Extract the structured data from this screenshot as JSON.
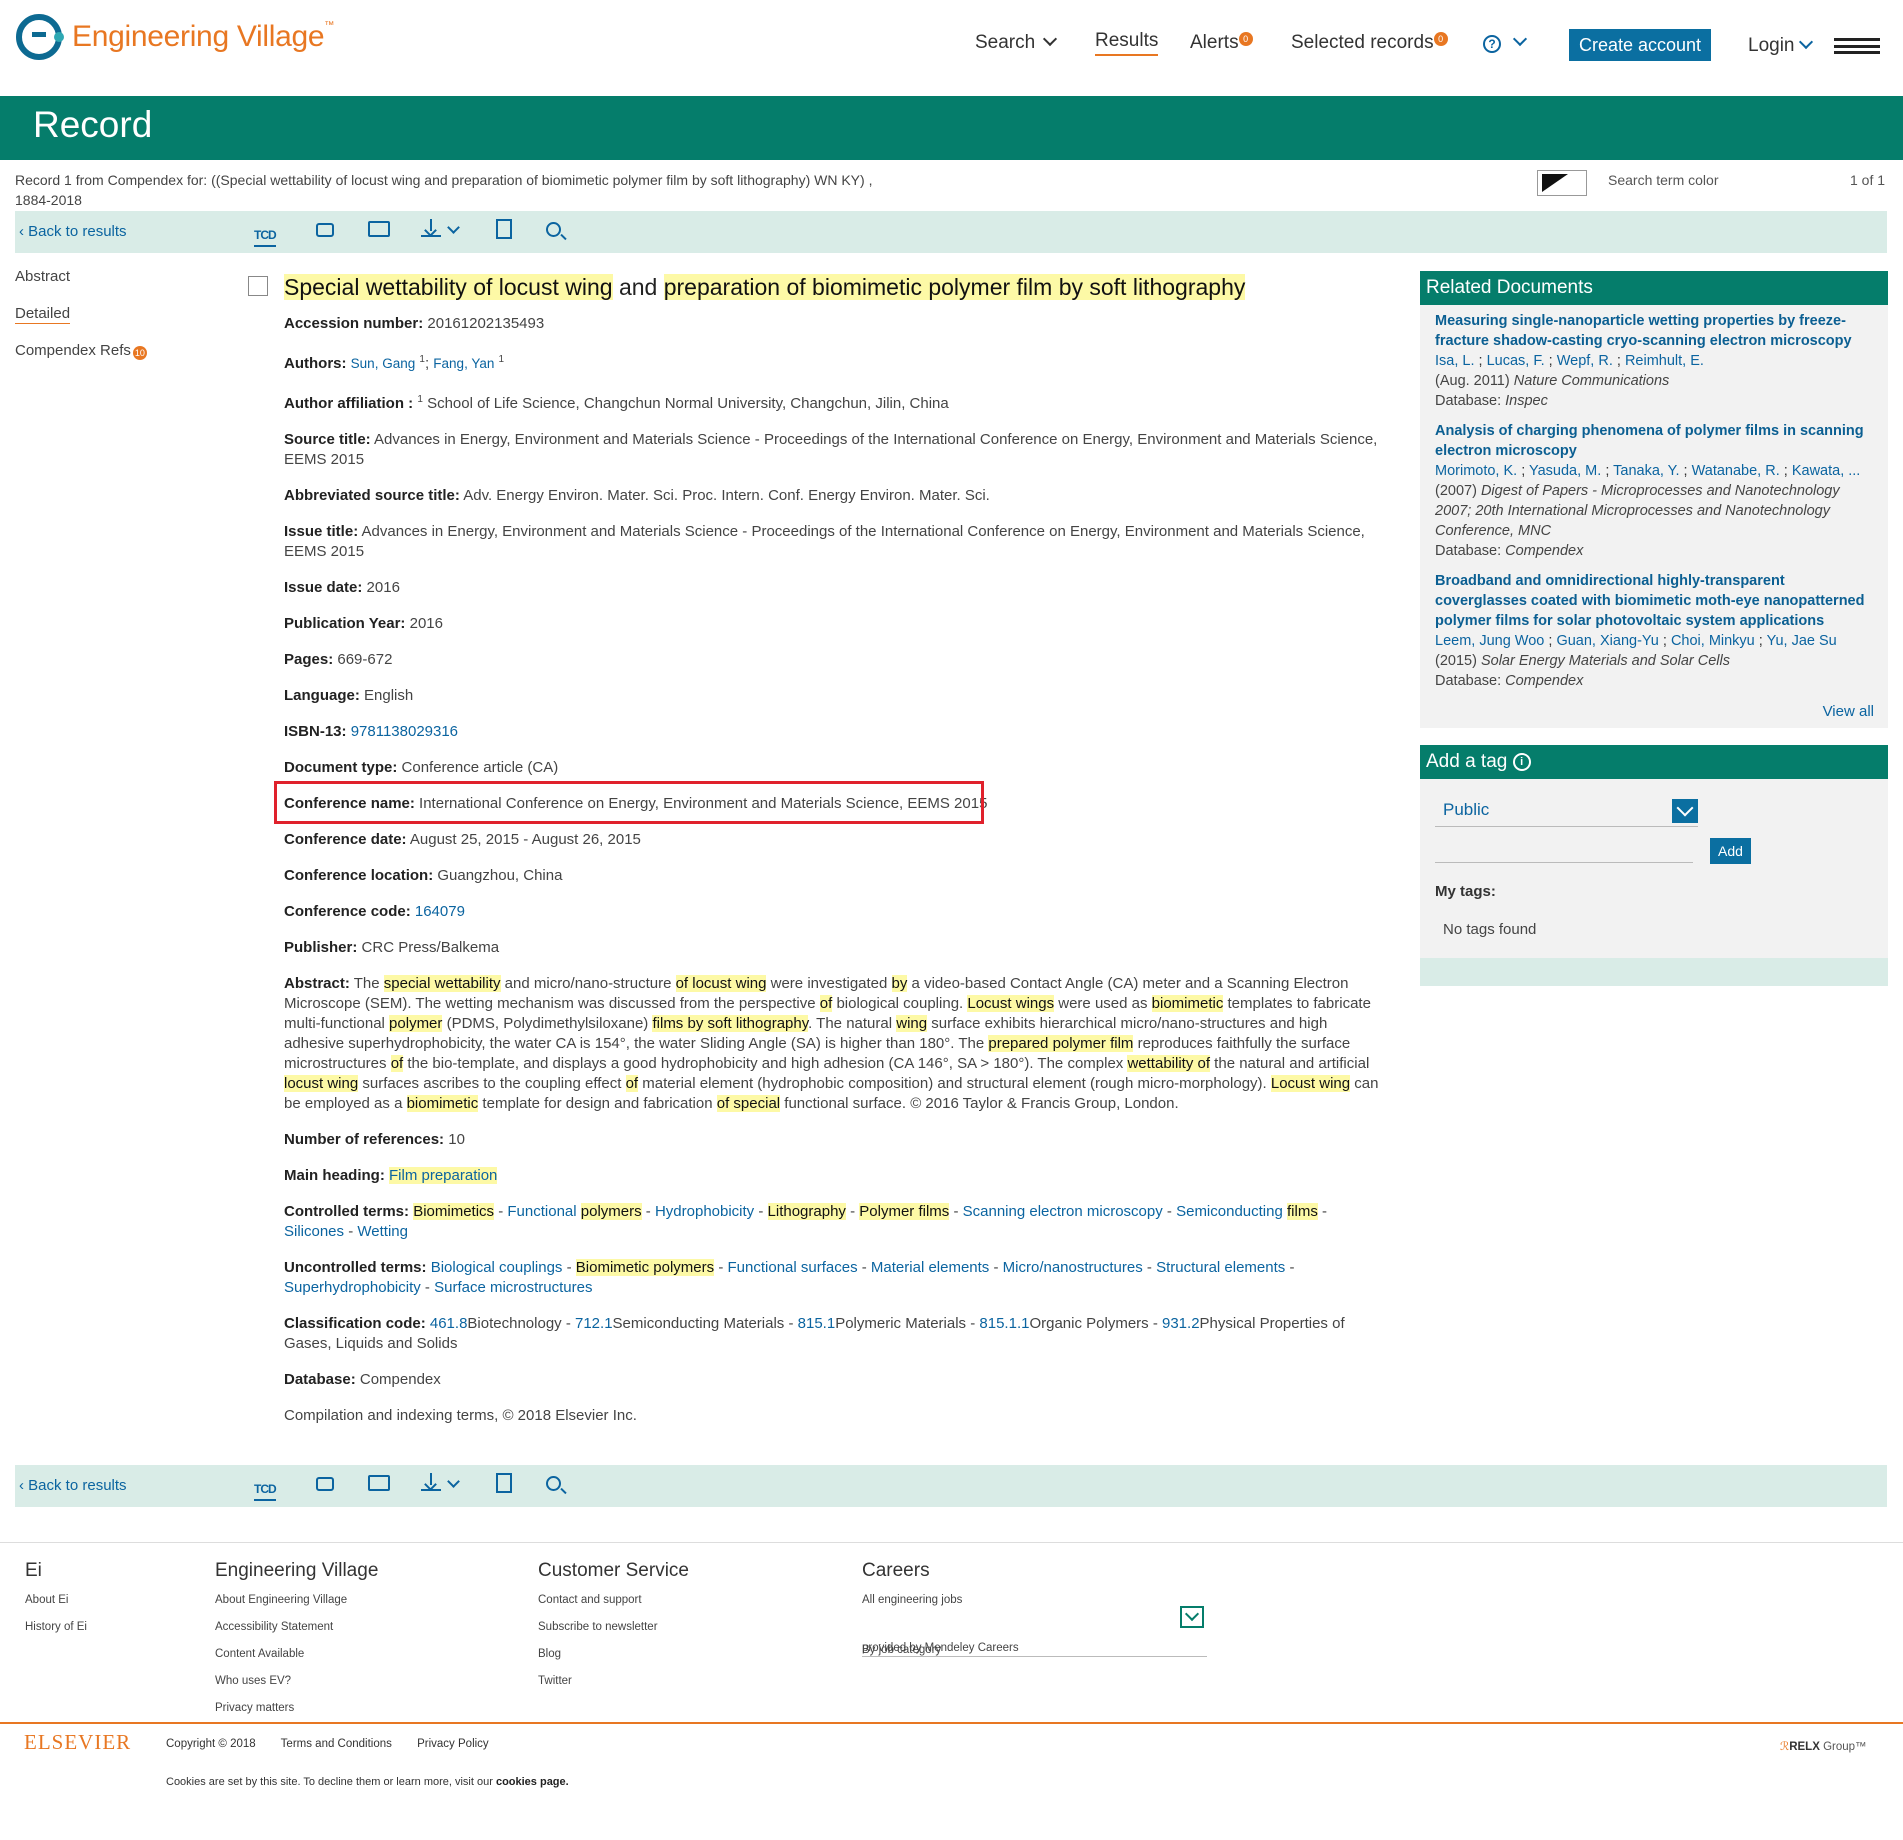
{
  "header": {
    "logo_text": "Engineering Village",
    "logo_tm": "™",
    "nav": {
      "search": "Search",
      "results": "Results",
      "alerts": "Alerts",
      "alerts_count": "0",
      "selected": "Selected records",
      "selected_count": "0",
      "help": "?",
      "create": "Create account",
      "login": "Login"
    }
  },
  "band_title": "Record",
  "crumb": {
    "line1": "Record 1 from Compendex for: ((Special wettability of locust wing and preparation of biomimetic polymer film by soft lithography) WN KY) ,",
    "line2": "1884-2018",
    "search_term_color": "Search term color",
    "pager": "1 of 1"
  },
  "toolbar": {
    "back": "Back to results",
    "tcd": "TCD"
  },
  "leftnav": {
    "abstract": "Abstract",
    "detailed": "Detailed",
    "refs": "Compendex Refs",
    "refs_count": "10"
  },
  "record": {
    "title_parts": [
      "Special wettability of locust wing",
      " and ",
      "preparation of biomimetic polymer film by soft lithography"
    ],
    "accession_label": "Accession number:",
    "accession": "20161202135493",
    "authors_label": "Authors:",
    "author1": "Sun, Gang",
    "author2": "Fang, Yan",
    "sup": "1",
    "affiliation_label": "Author affiliation :",
    "affiliation": "School of Life Science, Changchun Normal University, Changchun, Jilin, China",
    "source_label": "Source title:",
    "source": "Advances in Energy, Environment and Materials Science - Proceedings of the International Conference on Energy, Environment and Materials Science, EEMS 2015",
    "abbr_label": "Abbreviated source title:",
    "abbr": "Adv. Energy Environ. Mater. Sci. Proc. Intern. Conf. Energy Environ. Mater. Sci.",
    "issue_title_label": "Issue title:",
    "issue_title": "Advances in Energy, Environment and Materials Science - Proceedings of the International Conference on Energy, Environment and Materials Science, EEMS 2015",
    "issue_date_label": "Issue date:",
    "issue_date": "2016",
    "pub_year_label": "Publication Year:",
    "pub_year": "2016",
    "pages_label": "Pages:",
    "pages": "669-672",
    "language_label": "Language:",
    "language": "English",
    "isbn_label": "ISBN-13:",
    "isbn": "9781138029316",
    "doctype_label": "Document type:",
    "doctype": "Conference article (CA)",
    "conf_name_label": "Conference name:",
    "conf_name": "International Conference on Energy, Environment and Materials Science, EEMS 2015",
    "conf_date_label": "Conference date:",
    "conf_date": "August 25, 2015 - August 26, 2015",
    "conf_loc_label": "Conference location:",
    "conf_loc": "Guangzhou, China",
    "conf_code_label": "Conference code:",
    "conf_code": "164079",
    "publisher_label": "Publisher:",
    "publisher": "CRC Press/Balkema",
    "abstract_label": "Abstract:",
    "abstract": [
      [
        "The ",
        ""
      ],
      [
        "special wettability",
        "h"
      ],
      [
        " and micro/nano-structure ",
        ""
      ],
      [
        "of locust wing",
        "h"
      ],
      [
        " were investigated ",
        ""
      ],
      [
        "by",
        "h"
      ],
      [
        " a video-based Contact Angle (CA) meter and a Scanning Electron Microscope (SEM). The wetting mechanism was discussed from the perspective ",
        ""
      ],
      [
        "of",
        "h"
      ],
      [
        " biological coupling. ",
        ""
      ],
      [
        "Locust wings",
        "h"
      ],
      [
        " were used as ",
        ""
      ],
      [
        "biomimetic",
        "h"
      ],
      [
        " templates to fabricate multi-functional ",
        ""
      ],
      [
        "polymer",
        "h"
      ],
      [
        " (PDMS, Polydimethylsiloxane) ",
        ""
      ],
      [
        "films by soft lithography",
        "h"
      ],
      [
        ". The natural ",
        ""
      ],
      [
        "wing",
        "h"
      ],
      [
        " surface exhibits hierarchical micro/nano-structures and high adhesive superhydrophobicity, the water CA is 154°, the water Sliding Angle (SA) is higher than 180°. The ",
        ""
      ],
      [
        "prepared polymer film",
        "h"
      ],
      [
        " reproduces faithfully the surface microstructures ",
        ""
      ],
      [
        "of",
        "h"
      ],
      [
        " the bio-template, and displays a good hydrophobicity and high adhesion (CA 146°, SA > 180°). The complex ",
        ""
      ],
      [
        "wettability of",
        "h"
      ],
      [
        " the natural and artificial ",
        ""
      ],
      [
        "locust wing",
        "h"
      ],
      [
        " surfaces ascribes to the coupling effect ",
        ""
      ],
      [
        "of",
        "h"
      ],
      [
        " material element (hydrophobic composition) and structural element (rough micro-morphology). ",
        ""
      ],
      [
        "Locust wing",
        "h"
      ],
      [
        " can be employed as a ",
        ""
      ],
      [
        "biomimetic",
        "h"
      ],
      [
        " template for design and fabrication ",
        ""
      ],
      [
        "of special",
        "h"
      ],
      [
        " functional surface. © 2016 Taylor & Francis Group, London.",
        ""
      ]
    ],
    "nrefs_label": "Number of references:",
    "nrefs": "10",
    "heading_label": "Main heading:",
    "heading": "Film preparation",
    "controlled_label": "Controlled terms:",
    "controlled": [
      [
        [
          "Biomimetics",
          "h"
        ]
      ],
      [
        [
          "Functional ",
          ""
        ],
        [
          "polymers",
          "h"
        ]
      ],
      [
        [
          "Hydrophobicity",
          ""
        ]
      ],
      [
        [
          "Lithography",
          "h"
        ]
      ],
      [
        [
          "Polymer films",
          "h"
        ]
      ],
      [
        [
          "Scanning electron microscopy",
          ""
        ]
      ],
      [
        [
          "Semiconducting ",
          ""
        ],
        [
          "films",
          "h"
        ]
      ],
      [
        [
          "Silicones",
          ""
        ]
      ],
      [
        [
          "Wetting",
          ""
        ]
      ]
    ],
    "uncontrolled_label": "Uncontrolled terms:",
    "uncontrolled": [
      [
        [
          "Biological couplings",
          ""
        ]
      ],
      [
        [
          "Biomimetic polymers",
          "h"
        ]
      ],
      [
        [
          "Functional surfaces",
          ""
        ]
      ],
      [
        [
          "Material elements",
          ""
        ]
      ],
      [
        [
          "Micro/nanostructures",
          ""
        ]
      ],
      [
        [
          "Structural elements",
          ""
        ]
      ],
      [
        [
          "Superhydrophobicity",
          ""
        ]
      ],
      [
        [
          "Surface microstructures",
          ""
        ]
      ]
    ],
    "class_label": "Classification code:",
    "classes": [
      [
        "461.8",
        "Biotechnology"
      ],
      [
        "712.1",
        "Semiconducting Materials"
      ],
      [
        "815.1",
        "Polymeric Materials"
      ],
      [
        "815.1.1",
        "Organic Polymers"
      ],
      [
        "931.2",
        "Physical Properties of Gases, Liquids and Solids"
      ]
    ],
    "database_label": "Database:",
    "database": "Compendex",
    "compilation": "Compilation and indexing terms, © 2018 Elsevier Inc."
  },
  "related": {
    "title": "Related Documents",
    "items": [
      {
        "title": "Measuring single-nanoparticle wetting properties by freeze-fracture shadow-casting cryo-scanning electron microscopy",
        "authors": [
          "Isa, L.",
          "Lucas, F.",
          "Wepf, R.",
          "Reimhult, E."
        ],
        "source_prefix": "(Aug. 2011) ",
        "source": "Nature Communications",
        "db_label": "Database: ",
        "db": "Inspec"
      },
      {
        "title": "Analysis of charging phenomena of polymer films in scanning electron microscopy",
        "authors": [
          "Morimoto, K.",
          "Yasuda, M.",
          "Tanaka, Y.",
          "Watanabe, R.",
          "Kawata, ..."
        ],
        "source_prefix": "(2007) ",
        "source": "Digest of Papers - Microprocesses and Nanotechnology 2007; 20th International Microprocesses and Nanotechnology Conference, MNC",
        "db_label": "Database: ",
        "db": "Compendex"
      },
      {
        "title": "Broadband and omnidirectional highly-transparent coverglasses coated with biomimetic moth-eye nanopatterned polymer films for solar photovoltaic system applications",
        "authors": [
          "Leem, Jung Woo",
          "Guan, Xiang-Yu",
          "Choi, Minkyu",
          "Yu, Jae Su"
        ],
        "source_prefix": "(2015) ",
        "source": "Solar Energy Materials and Solar Cells",
        "db_label": "Database: ",
        "db": "Compendex"
      }
    ],
    "view_all": "View all"
  },
  "tag": {
    "title": "Add a tag",
    "info_icon": "i",
    "visibility": "Public",
    "add": "Add",
    "my_tags": "My tags:",
    "none": "No tags found"
  },
  "footer": {
    "ei": {
      "head": "Ei",
      "links": [
        "About Ei",
        "History of Ei"
      ]
    },
    "ev": {
      "head": "Engineering Village",
      "links": [
        "About Engineering Village",
        "Accessibility Statement",
        "Content Available",
        "Who uses EV?",
        "Privacy matters"
      ]
    },
    "cs": {
      "head": "Customer Service",
      "links": [
        "Contact and support",
        "Subscribe to newsletter",
        "Blog",
        "Twitter"
      ]
    },
    "careers": {
      "head": "Careers",
      "links": [
        "All engineering jobs"
      ],
      "select": "By job category",
      "provided": "provided by Mendeley Careers"
    },
    "elsevier": "ELSEVIER",
    "copyright": "Copyright © 2018",
    "terms": "Terms and Conditions",
    "privacy": "Privacy Policy",
    "relx": "RELX",
    "relx_group": "Group™",
    "cookie_prefix": "Cookies are set by this site. To decline them or learn more, visit our ",
    "cookie_link": "cookies page."
  }
}
